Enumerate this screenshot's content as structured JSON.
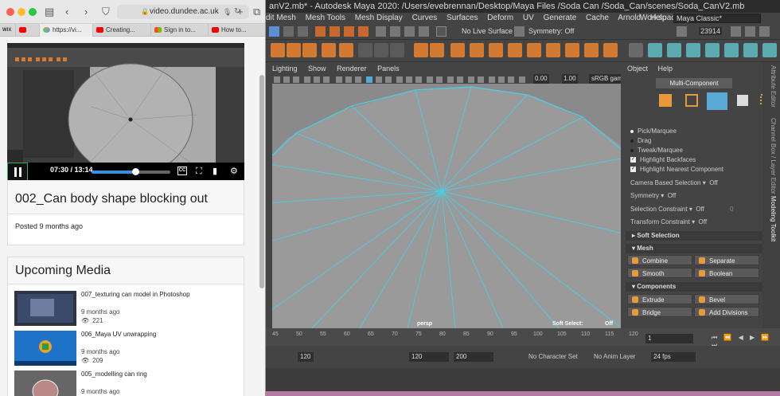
{
  "maya": {
    "title": "anV2.mb* - Autodesk Maya 2020: /Users/evebrennan/Desktop/Maya Files /Soda Can /Soda_Can/scenes/Soda_CanV2.mb",
    "menu": [
      "dit Mesh",
      "Mesh Tools",
      "Mesh Display",
      "Curves",
      "Surfaces",
      "Deform",
      "UV",
      "Generate",
      "Cache",
      "Arnold",
      "Help"
    ],
    "workspace_label": "Workspace :",
    "workspace_value": "Maya Classic*",
    "status": {
      "live_surface": "No Live Surface",
      "symmetry": "Symmetry: Off",
      "count": "23914"
    },
    "panel_menu": [
      "Lighting",
      "Show",
      "Renderer",
      "Panels"
    ],
    "panel_values": {
      "v1": "0.00",
      "v2": "1.00",
      "gamma": "sRGB gamm"
    },
    "viewport": {
      "camera": "persp",
      "soft_select_label": "Soft Select:",
      "soft_select_value": "Off"
    },
    "right_panel": {
      "menu": [
        "Object",
        "Help"
      ],
      "mode": "Multi-Component",
      "pick": "Pick/Marquee",
      "drag": "Drag",
      "tweak": "Tweak/Marquee",
      "highlight_backfaces": "Highlight Backfaces",
      "highlight_nearest": "Highlight Nearest Component",
      "camera_sel": "Camera Based Selection",
      "camera_sel_val": "Off",
      "symmetry": "Symmetry",
      "symmetry_val": "Off",
      "sel_constraint": "Selection Constraint",
      "sel_constraint_val": "Off",
      "sel_constraint_num": "0",
      "transform_constraint": "Transform Constraint",
      "transform_constraint_val": "Off",
      "soft_selection": "Soft Selection",
      "mesh": "Mesh",
      "combine": "Combine",
      "separate": "Separate",
      "smooth": "Smooth",
      "boolean": "Boolean",
      "components": "Components",
      "extrude": "Extrude",
      "bevel": "Bevel",
      "bridge": "Bridge",
      "add_divisions": "Add Divisions"
    },
    "vtabs": [
      "Attribute Editor",
      "Channel Box / Layer Editor",
      "Modeling Toolkit"
    ],
    "timeline": {
      "ticks": [
        "45",
        "50",
        "55",
        "60",
        "65",
        "70",
        "75",
        "80",
        "85",
        "90",
        "95",
        "100",
        "105",
        "110",
        "115",
        "120"
      ],
      "current_frame": "1"
    },
    "range": {
      "end_inner": "120",
      "start": "120",
      "end": "200",
      "character_set": "No Character Set",
      "anim_layer": "No Anim Layer",
      "fps": "24 fps"
    }
  },
  "safari": {
    "url": "video.dundee.ac.uk",
    "tabs": [
      "WIX",
      "",
      "https://vi...",
      "Creating...",
      "Sign in to...",
      "How to..."
    ],
    "video": {
      "time": "07:30 / 13:14",
      "progress": 0.56
    },
    "video_title": "002_Can body shape blocking out",
    "posted": "Posted 9 months ago",
    "upcoming_title": "Upcoming Media",
    "upcoming": [
      {
        "title": "007_texturing can model in Photoshop",
        "date": "9 months ago",
        "views": "221"
      },
      {
        "title": "006_Maya UV unwrapping",
        "date": "9 months ago",
        "views": "209"
      },
      {
        "title": "005_modelling can ring",
        "date": "9 months ago",
        "views": ""
      }
    ]
  },
  "colors": {
    "wire": "#4fc9e0",
    "viewport_bg": "#8a8a8a",
    "accent_orange": "#e69a3c",
    "player_progress": "#3a8fe0"
  }
}
